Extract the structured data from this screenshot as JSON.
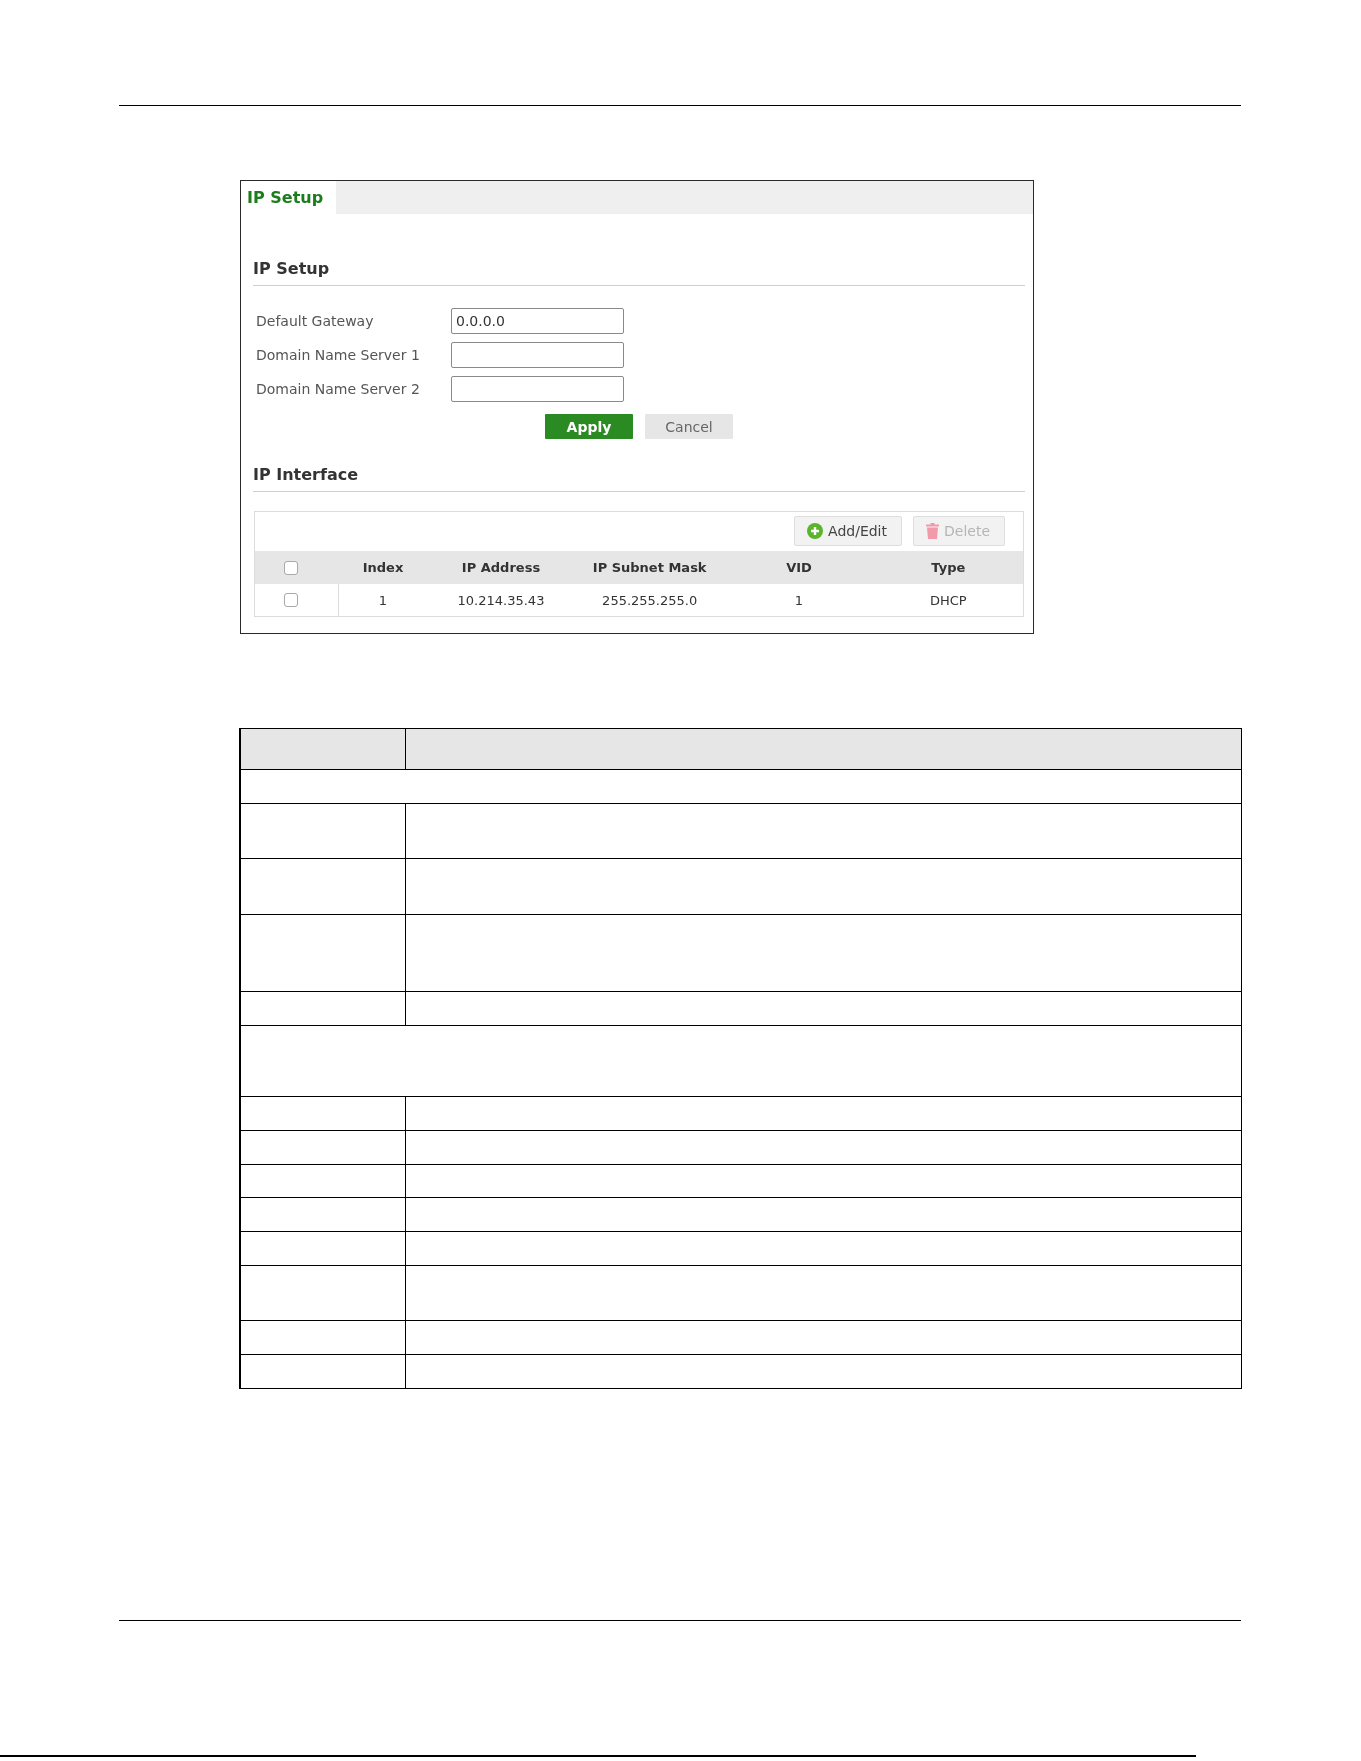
{
  "tabs": [
    {
      "label": "IP Setup",
      "selected": true
    }
  ],
  "ip_setup": {
    "title": "IP Setup",
    "fields": [
      {
        "label": "Default Gateway",
        "value": "0.0.0.0"
      },
      {
        "label": "Domain Name Server 1"
      },
      {
        "label": "Domain Name Server 2"
      }
    ],
    "buttons": [
      {
        "label": "Apply",
        "kind": "primary"
      },
      {
        "label": "Cancel",
        "kind": "secondary"
      }
    ]
  },
  "ip_interface": {
    "title": "IP Interface",
    "toolbar": [
      {
        "label": "Add/Edit",
        "kind": "add",
        "disabled": false
      },
      {
        "label": "Delete",
        "kind": "delete",
        "disabled": true
      }
    ],
    "header_checked": false,
    "columns": [
      "Index",
      "IP Address",
      "IP Subnet Mask",
      "VID",
      "Type"
    ],
    "rows": [
      {
        "checked": false,
        "cells": [
          "1",
          "10.214.35.43",
          "255.255.255.0",
          "1",
          "DHCP"
        ]
      }
    ]
  },
  "description_table": {
    "rows": [
      {
        "kind": "header"
      },
      {
        "kind": "section"
      },
      {
        "kind": "entry"
      },
      {
        "kind": "entry"
      },
      {
        "kind": "entry"
      },
      {
        "kind": "entry"
      },
      {
        "kind": "section"
      },
      {
        "kind": "entry"
      },
      {
        "kind": "entry"
      },
      {
        "kind": "entry"
      },
      {
        "kind": "entry"
      },
      {
        "kind": "entry"
      },
      {
        "kind": "entry"
      },
      {
        "kind": "entry"
      },
      {
        "kind": "entry"
      }
    ]
  }
}
